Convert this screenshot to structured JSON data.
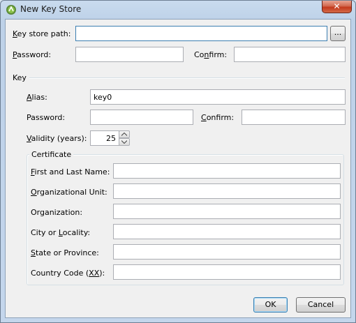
{
  "window": {
    "title": "New Key Store",
    "icon": "android-studio-icon",
    "close_symbol": "✕"
  },
  "keystore": {
    "path_label": "Key store path:",
    "path_accel": "K",
    "path_rest": "ey store path:",
    "path_value": "",
    "browse_label": "...",
    "password_accel": "P",
    "password_rest": "assword:",
    "password_value": "",
    "confirm_pre": "Co",
    "confirm_accel": "n",
    "confirm_rest": "firm:",
    "confirm_value": ""
  },
  "key": {
    "section_label": "Key",
    "alias_accel": "A",
    "alias_rest": "lias:",
    "alias_value": "key0",
    "password_label": "Password:",
    "password_value": "",
    "confirm_accel": "C",
    "confirm_rest": "onfirm:",
    "confirm_value": "",
    "validity_accel": "V",
    "validity_rest": "alidity (years):",
    "validity_value": "25"
  },
  "certificate": {
    "group_label": "Certificate",
    "fields": [
      {
        "accel": "F",
        "rest": "irst and Last Name:",
        "pre": "",
        "value": ""
      },
      {
        "accel": "O",
        "rest": "rganizational Unit:",
        "pre": "",
        "value": ""
      },
      {
        "accel": "",
        "rest": "Organization:",
        "pre": "",
        "value": ""
      },
      {
        "pre": "City or ",
        "accel": "L",
        "rest": "ocality:",
        "value": ""
      },
      {
        "accel": "S",
        "rest": "tate or Province:",
        "pre": "",
        "value": ""
      },
      {
        "pre": "Country Code (",
        "accel": "XX",
        "rest": "):",
        "value": ""
      }
    ]
  },
  "footer": {
    "ok_label": "OK",
    "cancel_label": "Cancel"
  }
}
